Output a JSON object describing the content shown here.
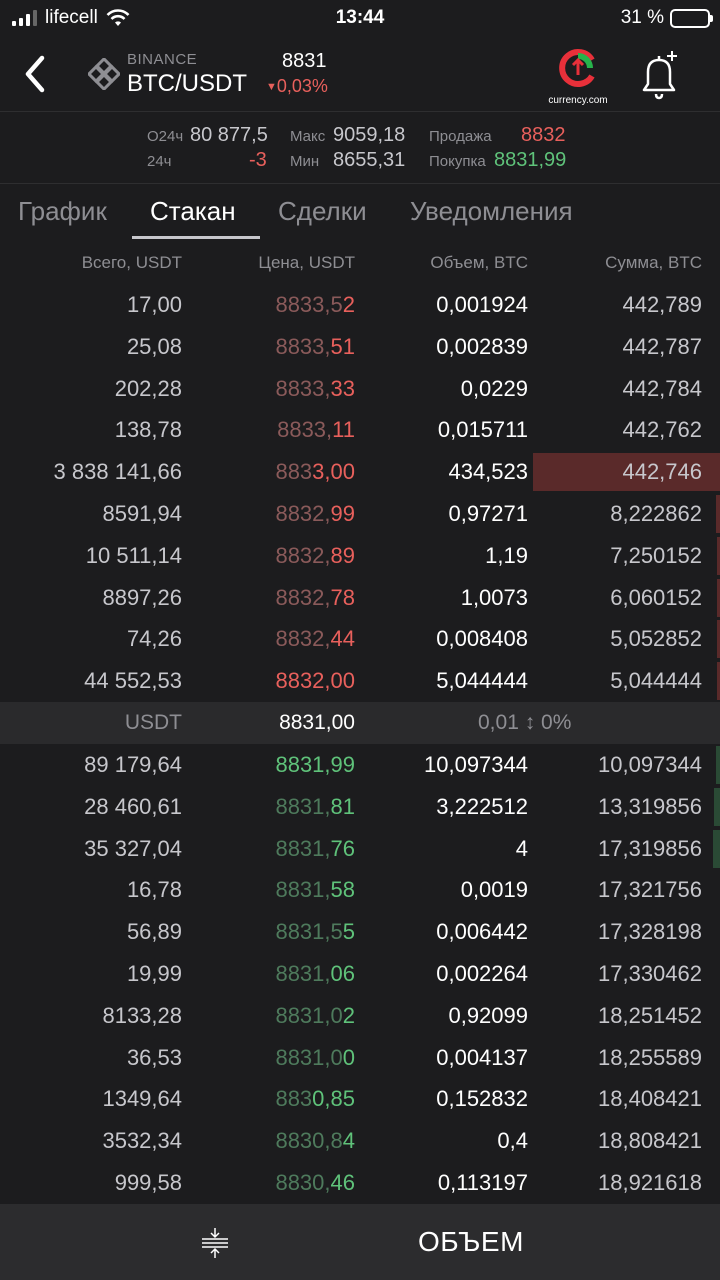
{
  "status_bar": {
    "carrier": "lifecell",
    "time": "13:44",
    "battery": "31 %",
    "battery_level": 0.31
  },
  "header": {
    "exchange": "BINANCE",
    "pair": "BTC/USDT",
    "price": "8831",
    "change": "0,03%",
    "logo_text": "currency.com"
  },
  "stats": {
    "volume_label": "О24ч",
    "volume_value": "80 877,5",
    "change_label": "24ч",
    "change_value": "-3",
    "max_label": "Макс",
    "max_value": "9059,18",
    "min_label": "Мин",
    "min_value": "8655,31",
    "sell_label": "Продажа",
    "sell_value": "8832",
    "buy_label": "Покупка",
    "buy_value": "8831,99"
  },
  "tabs": [
    {
      "label": "График"
    },
    {
      "label": "Стакан"
    },
    {
      "label": "Сделки"
    },
    {
      "label": "Уведомления"
    }
  ],
  "columns": {
    "total": "Всего, USDT",
    "price": "Цена, USDT",
    "volume": "Объем, BTC",
    "sum": "Сумма, BTC"
  },
  "asks": [
    {
      "total": "17,00",
      "price_a": "8833,5",
      "price_b": "2",
      "volume": "0,001924",
      "sum": "442,789",
      "depth": 0
    },
    {
      "total": "25,08",
      "price_a": "8833,",
      "price_b": "51",
      "volume": "0,002839",
      "sum": "442,787",
      "depth": 0
    },
    {
      "total": "202,28",
      "price_a": "8833,",
      "price_b": "33",
      "volume": "0,0229",
      "sum": "442,784",
      "depth": 0
    },
    {
      "total": "138,78",
      "price_a": "8833,",
      "price_b": "11",
      "volume": "0,015711",
      "sum": "442,762",
      "depth": 0
    },
    {
      "total": "3 838 141,66",
      "price_a": "883",
      "price_b": "3,00",
      "volume": "434,523",
      "sum": "442,746",
      "depth": 1.0
    },
    {
      "total": "8591,94",
      "price_a": "8832,",
      "price_b": "99",
      "volume": "0,97271",
      "sum": "8,222862",
      "depth": 0.019
    },
    {
      "total": "10 511,14",
      "price_a": "8832,",
      "price_b": "89",
      "volume": "1,19",
      "sum": "7,250152",
      "depth": 0.016
    },
    {
      "total": "8897,26",
      "price_a": "8832,",
      "price_b": "78",
      "volume": "1,0073",
      "sum": "6,060152",
      "depth": 0.014
    },
    {
      "total": "74,26",
      "price_a": "8832,",
      "price_b": "44",
      "volume": "0,008408",
      "sum": "5,052852",
      "depth": 0.011
    },
    {
      "total": "44 552,53",
      "price_a": "",
      "price_b": "8832,00",
      "volume": "5,044444",
      "sum": "5,044444",
      "depth": 0.011
    }
  ],
  "mid": {
    "currency": "USDT",
    "price": "8831,00",
    "spread": "0,01 ↕ 0%"
  },
  "bids": [
    {
      "total": "89 179,64",
      "price_a": "",
      "price_b": "8831,99",
      "volume": "10,097344",
      "sum": "10,097344",
      "depth": 0.023
    },
    {
      "total": "28 460,61",
      "price_a": "8831,",
      "price_b": "81",
      "volume": "3,222512",
      "sum": "13,319856",
      "depth": 0.03
    },
    {
      "total": "35 327,04",
      "price_a": "8831,",
      "price_b": "76",
      "volume": "4",
      "sum": "17,319856",
      "depth": 0.039
    },
    {
      "total": "16,78",
      "price_a": "8831,",
      "price_b": "58",
      "volume": "0,0019",
      "sum": "17,321756",
      "depth": 0
    },
    {
      "total": "56,89",
      "price_a": "8831,5",
      "price_b": "5",
      "volume": "0,006442",
      "sum": "17,328198",
      "depth": 0
    },
    {
      "total": "19,99",
      "price_a": "8831,",
      "price_b": "06",
      "volume": "0,002264",
      "sum": "17,330462",
      "depth": 0
    },
    {
      "total": "8133,28",
      "price_a": "8831,0",
      "price_b": "2",
      "volume": "0,92099",
      "sum": "18,251452",
      "depth": 0
    },
    {
      "total": "36,53",
      "price_a": "8831,0",
      "price_b": "0",
      "volume": "0,004137",
      "sum": "18,255589",
      "depth": 0
    },
    {
      "total": "1349,64",
      "price_a": "883",
      "price_b": "0,85",
      "volume": "0,152832",
      "sum": "18,408421",
      "depth": 0
    },
    {
      "total": "3532,34",
      "price_a": "8830,8",
      "price_b": "4",
      "volume": "0,4",
      "sum": "18,808421",
      "depth": 0
    },
    {
      "total": "999,58",
      "price_a": "8830,",
      "price_b": "46",
      "volume": "0,113197",
      "sum": "18,921618",
      "depth": 0
    }
  ],
  "bottom_bar": {
    "label": "ОБЪЕМ"
  }
}
